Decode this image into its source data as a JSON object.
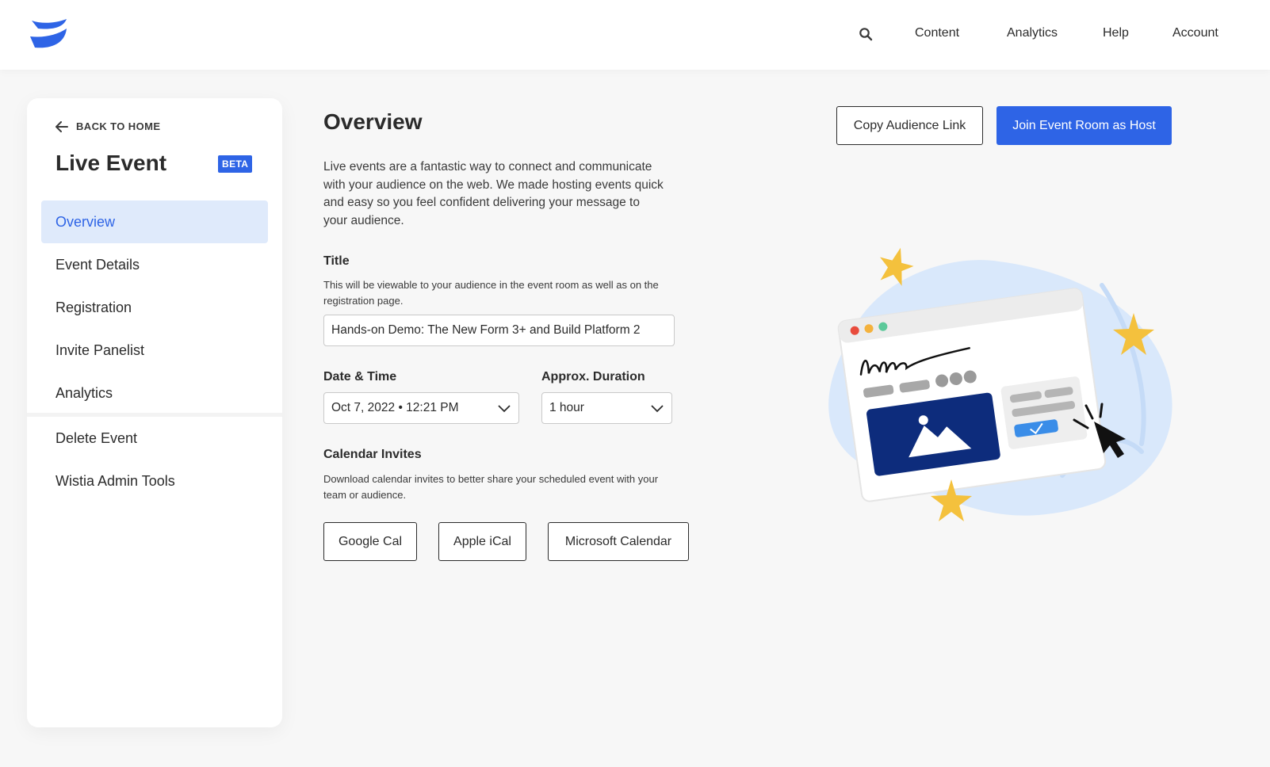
{
  "nav": {
    "logo_icon": "wistia-logo-icon",
    "search_icon": "search-icon",
    "links": [
      "Content",
      "Analytics",
      "Help",
      "Account"
    ]
  },
  "sidebar": {
    "back_label": "BACK TO HOME",
    "title": "Live Event",
    "badge": "BETA",
    "items": [
      "Overview",
      "Event Details",
      "Registration",
      "Invite Panelist",
      "Analytics"
    ],
    "active_item": "Overview",
    "secondary_items": [
      "Delete Event",
      "Wistia Admin Tools"
    ]
  },
  "main": {
    "title": "Overview",
    "intro": "Live events are a fantastic way to connect and communicate with your audience on the web. We made hosting events quick and easy so you feel confident delivering your message to your audience.",
    "title_field": {
      "label": "Title",
      "help": "This will be viewable to your audience in the event room as well as on the registration page.",
      "value": "Hands-on Demo: The New Form 3+ and Build Platform 2"
    },
    "datetime_field": {
      "label": "Date & Time",
      "value": "Oct 7, 2022 • 12:21 PM"
    },
    "duration_field": {
      "label": "Approx. Duration",
      "value": "1 hour"
    },
    "calendar": {
      "label": "Calendar Invites",
      "help": "Download calendar invites to better share your scheduled event with your team or audience.",
      "buttons": [
        "Google Cal",
        "Apple iCal",
        "Microsoft Calendar"
      ]
    },
    "actions": {
      "copy_link": "Copy Audience Link",
      "join_host": "Join Event Room as Host"
    }
  },
  "colors": {
    "accent": "#2e64e6",
    "active_bg": "#dfeafb",
    "page_bg": "#f7f7f7",
    "illustration_navy": "#0d2c7c",
    "star_yellow": "#f4c13d"
  }
}
